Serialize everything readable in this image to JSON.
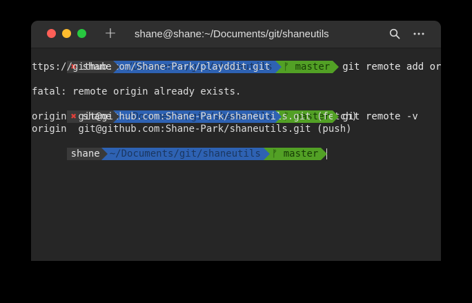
{
  "window": {
    "title": "shane@shane:~/Documents/git/shaneutils",
    "new_tab_icon": "plus-icon",
    "search_icon": "search-icon",
    "more_icon": "more-icon",
    "traffic_lights": {
      "close": "#fe5f57",
      "minimize": "#febc2e",
      "zoom": "#28c840"
    }
  },
  "prompt": {
    "user": "shane",
    "path": "~/Documents/git/shaneutils",
    "branch": "master",
    "branch_glyph": "ᚠ",
    "error_mark": "✖",
    "colors": {
      "user_bg": "#3a3a3a",
      "path_bg": "#2e62b3",
      "git_bg": "#52a025",
      "error": "#e0403a"
    }
  },
  "terminal": {
    "cmd1": "git remote add origin h",
    "cmd1_wrap": "ttps://github.com/Shane-Park/playddit.git",
    "blank": "",
    "error": "fatal: remote origin already exists.",
    "cmd2": "git remote -v",
    "out1": "origin  git@github.com:Shane-Park/shaneutils.git (fetch)",
    "out2": "origin  git@github.com:Shane-Park/shaneutils.git (push)"
  }
}
